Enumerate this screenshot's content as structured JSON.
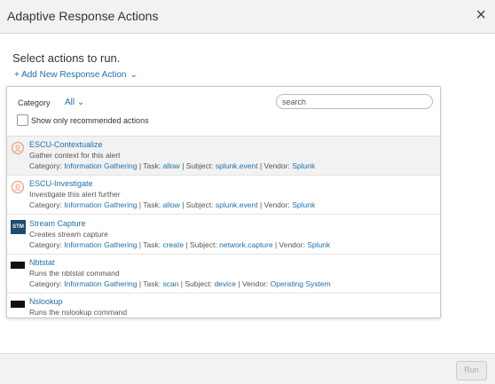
{
  "dialog": {
    "title": "Adaptive Response Actions",
    "close_glyph": "×",
    "prompt": "Select actions to run.",
    "add_action_label": "+ Add New Response Action",
    "add_action_chevron": "⌄"
  },
  "filters": {
    "category_label": "Category",
    "category_value": "All",
    "category_chevron": "⌄",
    "search_placeholder": "search",
    "recommended_label": "Show only recommended actions",
    "recommended_checked": false
  },
  "actions": [
    {
      "name": "ESCU-Contextualize",
      "description": "Gather context for this alert",
      "icon": "escu-icon",
      "category_label": "Category:",
      "category": "Information Gathering",
      "task_label": "Task:",
      "task": "allow",
      "subject_label": "Subject:",
      "subject": "splunk.event",
      "vendor_label": "Vendor:",
      "vendor": "Splunk",
      "selected": true
    },
    {
      "name": "ESCU-Investigate",
      "description": "Investigate this alert further",
      "icon": "escu-icon",
      "category_label": "Category:",
      "category": "Information Gathering",
      "task_label": "Task:",
      "task": "allow",
      "subject_label": "Subject:",
      "subject": "splunk.event",
      "vendor_label": "Vendor:",
      "vendor": "Splunk",
      "selected": false
    },
    {
      "name": "Stream Capture",
      "description": "Creates stream capture",
      "icon": "stm-icon",
      "badge": "STM",
      "category_label": "Category:",
      "category": "Information Gathering",
      "task_label": "Task:",
      "task": "create",
      "subject_label": "Subject:",
      "subject": "network.capture",
      "vendor_label": "Vendor:",
      "vendor": "Splunk",
      "selected": false
    },
    {
      "name": "Nbtstat",
      "description": "Runs the nbtstat command",
      "icon": "nbtstat-icon",
      "category_label": "Category:",
      "category": "Information Gathering",
      "task_label": "Task:",
      "task": "scan",
      "subject_label": "Subject:",
      "subject": "device",
      "vendor_label": "Vendor:",
      "vendor": "Operating System",
      "selected": false
    },
    {
      "name": "Nslookup",
      "description": "Runs the nslookup command",
      "icon": "nslookup-icon",
      "selected": false
    }
  ],
  "footer": {
    "run_label": "Run",
    "run_enabled": false
  },
  "colors": {
    "link": "#1f6fa8",
    "header_bg": "#f2f2f2",
    "selected_row_bg": "#f2f2f2",
    "stm_badge": "#1d4c72",
    "escu_icon": "#f0a078"
  }
}
